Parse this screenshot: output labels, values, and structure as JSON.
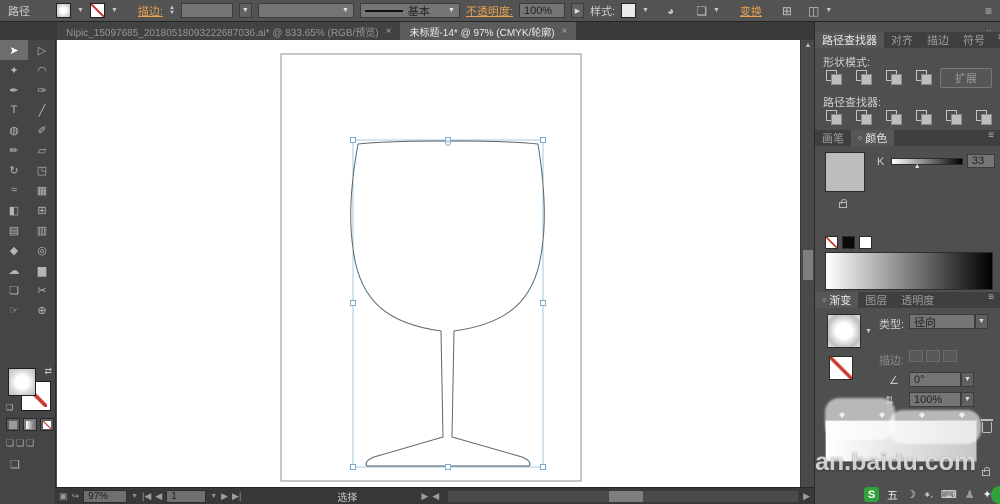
{
  "control_bar": {
    "path_label": "路径",
    "stroke_label": "描边:",
    "line_style_value": "基本",
    "opacity_label": "不透明度:",
    "opacity_value": "100%",
    "style_label": "样式:",
    "transform_link": "变换"
  },
  "doc_tabs": [
    {
      "title": "Nipic_15097685_20180518093222687036.ai* @ 833.65% (RGB/预览)",
      "close": "×"
    },
    {
      "title": "未标题-14* @ 97% (CMYK/轮廓)",
      "close": "×"
    }
  ],
  "toolbar": {
    "tools": [
      {
        "name": "selection-tool",
        "glyph": "➤"
      },
      {
        "name": "direct-selection-tool",
        "glyph": "▷"
      },
      {
        "name": "magic-wand-tool",
        "glyph": "✦"
      },
      {
        "name": "lasso-tool",
        "glyph": "◠"
      },
      {
        "name": "pen-tool",
        "glyph": "✒"
      },
      {
        "name": "curvature-pen-tool",
        "glyph": "✑"
      },
      {
        "name": "type-tool",
        "glyph": "T"
      },
      {
        "name": "line-segment-tool",
        "glyph": "╱"
      },
      {
        "name": "blob-brush-tool",
        "glyph": "◍"
      },
      {
        "name": "paintbrush-tool",
        "glyph": "✐"
      },
      {
        "name": "pencil-tool",
        "glyph": "✏"
      },
      {
        "name": "eraser-tool",
        "glyph": "▱"
      },
      {
        "name": "rotate-tool",
        "glyph": "↻"
      },
      {
        "name": "scale-tool",
        "glyph": "◳"
      },
      {
        "name": "width-tool",
        "glyph": "≈"
      },
      {
        "name": "free-transform-tool",
        "glyph": "▦"
      },
      {
        "name": "shape-builder-tool",
        "glyph": "◧"
      },
      {
        "name": "perspective-grid-tool",
        "glyph": "⊞"
      },
      {
        "name": "mesh-tool",
        "glyph": "▤"
      },
      {
        "name": "gradient-tool",
        "glyph": "▥"
      },
      {
        "name": "eyedropper-tool",
        "glyph": "◆"
      },
      {
        "name": "blend-tool",
        "glyph": "◎"
      },
      {
        "name": "symbol-sprayer-tool",
        "glyph": "☁"
      },
      {
        "name": "column-graph-tool",
        "glyph": "▆"
      },
      {
        "name": "artboard-tool",
        "glyph": "❏"
      },
      {
        "name": "slice-tool",
        "glyph": "✂"
      },
      {
        "name": "hand-tool",
        "glyph": "☞"
      },
      {
        "name": "zoom-tool",
        "glyph": "⊕"
      }
    ]
  },
  "pathfinder_panel": {
    "tabs": [
      "路径查找器",
      "对齐",
      "描边",
      "符号"
    ],
    "shape_modes_label": "形状模式:",
    "expand_label": "扩展",
    "pathfinder_label": "路径查找器:"
  },
  "color_panel": {
    "tabs": [
      "画笔",
      "颜色"
    ],
    "channel_label": "K",
    "channel_value": "33"
  },
  "gradient_panel": {
    "tabs": [
      "渐变",
      "图层",
      "透明度"
    ],
    "type_label": "类型:",
    "type_value": "径向",
    "stroke_label": "描边:",
    "angle_value": "0°",
    "aspect_value": "100%"
  },
  "status_bar": {
    "zoom_value": "97%",
    "artboard_value": "1",
    "mode_label": "选择"
  },
  "watermark": {
    "text": "an.baidu.com"
  },
  "ime": {
    "engine_label": "S",
    "mode_label": "五"
  },
  "colors": {
    "accent_orange": "#e8a14f",
    "selection_blue": "#a9cade",
    "outline_stroke": "#5a6770",
    "ime_green": "#2fa23c"
  }
}
